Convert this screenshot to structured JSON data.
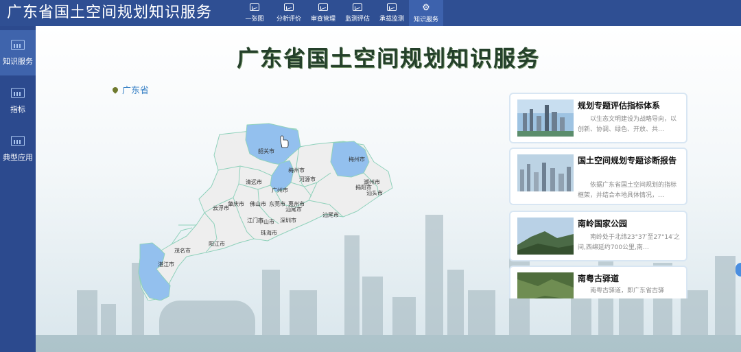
{
  "app": {
    "title": "广东省国土空间规划知识服务"
  },
  "nav": {
    "items": [
      {
        "label": "一张图",
        "icon": "monitor-chart-icon"
      },
      {
        "label": "分析评价",
        "icon": "monitor-chart-icon"
      },
      {
        "label": "审查管理",
        "icon": "monitor-chart-icon"
      },
      {
        "label": "监测评估",
        "icon": "monitor-chart-icon"
      },
      {
        "label": "承载监测",
        "icon": "monitor-chart-icon"
      },
      {
        "label": "知识服务",
        "icon": "gear-icon"
      }
    ],
    "active": "知识服务"
  },
  "sidebar": {
    "items": [
      {
        "label": "知识服务",
        "icon": "chart-icon"
      },
      {
        "label": "指标",
        "icon": "chart-icon"
      },
      {
        "label": "典型应用",
        "icon": "chart-icon"
      }
    ],
    "active": "知识服务"
  },
  "main": {
    "title": "广东省国土空间规划知识服务",
    "location": "广东省"
  },
  "map": {
    "cities": [
      "韶关市",
      "梅州市",
      "清远市",
      "河源市",
      "潮州市",
      "揭阳市",
      "汕头市",
      "广州市",
      "肇庆市",
      "佛山市",
      "东莞市",
      "惠州市",
      "云浮市",
      "江门市",
      "中山市",
      "深圳市",
      "汕尾市",
      "珠海市",
      "茂名市",
      "阳江市",
      "湛江市"
    ],
    "highlighted": [
      "韶关市",
      "梅州市",
      "广州市",
      "湛江市"
    ],
    "colors": {
      "highlight": "#93c0ee",
      "base": "#eeeeee",
      "border": "#8fd1bb"
    }
  },
  "cards": [
    {
      "title": "规划专题评估指标体系",
      "description": "以生态文明建设为战略导向，以创新、协调、绿色、开放、共…"
    },
    {
      "title": "国土空间规划专题诊断报告",
      "description": "依据广东省国土空间规划的指标框架，并结合本地具体情况，…"
    },
    {
      "title": "南岭国家公园",
      "description": "南岭处于北纬23°37′至27°14′之间,西绵延约700公里,南…"
    },
    {
      "title": "南粤古驿道",
      "description": "南粤古驿道，即广东省古驿"
    }
  ],
  "colors": {
    "header": "#2f4f93",
    "sidebar": "#2c4a8e",
    "accent": "#3b83c6"
  }
}
